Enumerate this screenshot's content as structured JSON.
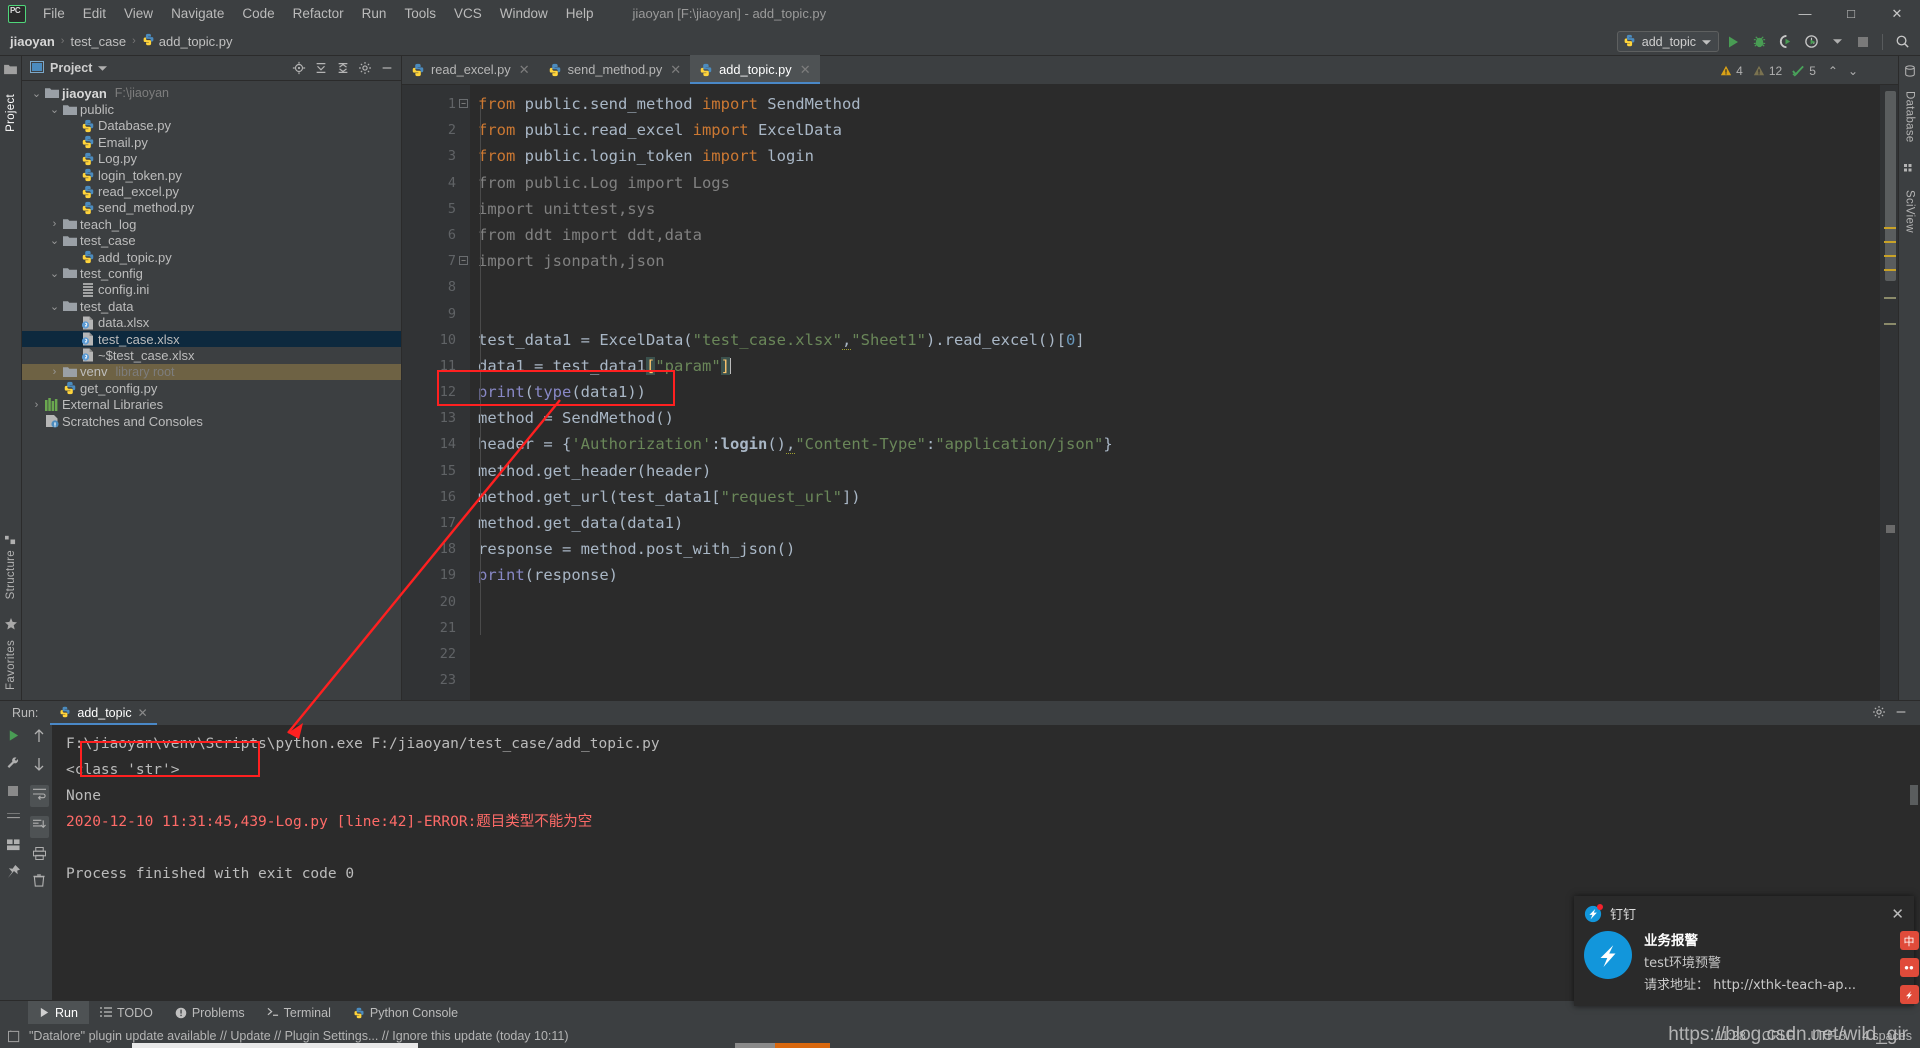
{
  "window": {
    "title": "jiaoyan [F:\\jiaoyan] - add_topic.py",
    "minimize": "—",
    "maximize": "□",
    "close": "✕"
  },
  "menu": {
    "logo": "pycharm-logo",
    "items": [
      "File",
      "Edit",
      "View",
      "Navigate",
      "Code",
      "Refactor",
      "Run",
      "Tools",
      "VCS",
      "Window",
      "Help"
    ]
  },
  "breadcrumb": {
    "items": [
      "jiaoyan",
      "test_case",
      "add_topic.py"
    ],
    "separator": "›"
  },
  "toolbar": {
    "run_config": "add_topic",
    "icons": [
      "run-icon",
      "debug-icon",
      "run-coverage-icon",
      "profile-icon",
      "stop-icon",
      "search-icon"
    ]
  },
  "left_strip": {
    "top": [
      "Project"
    ],
    "bottom": [
      "Structure",
      "Favorites"
    ]
  },
  "right_strip": {
    "items": [
      "Database",
      "SciView"
    ]
  },
  "project_panel": {
    "title": "Project",
    "header_icons": [
      "locate-icon",
      "expand-all-icon",
      "collapse-all-icon",
      "gear-icon",
      "hide-icon"
    ],
    "tree": [
      {
        "depth": 0,
        "twisty": "⌄",
        "icon": "folder-icon",
        "label": "jiaoyan",
        "bold": true,
        "hint": "F:\\jiaoyan",
        "state": "normal"
      },
      {
        "depth": 1,
        "twisty": "⌄",
        "icon": "folder-icon",
        "label": "public",
        "bold": false,
        "hint": "",
        "state": "normal"
      },
      {
        "depth": 2,
        "twisty": "",
        "icon": "python-file-icon",
        "label": "Database.py",
        "bold": false,
        "hint": "",
        "state": "normal"
      },
      {
        "depth": 2,
        "twisty": "",
        "icon": "python-file-icon",
        "label": "Email.py",
        "bold": false,
        "hint": "",
        "state": "normal"
      },
      {
        "depth": 2,
        "twisty": "",
        "icon": "python-file-icon",
        "label": "Log.py",
        "bold": false,
        "hint": "",
        "state": "normal"
      },
      {
        "depth": 2,
        "twisty": "",
        "icon": "python-file-icon",
        "label": "login_token.py",
        "bold": false,
        "hint": "",
        "state": "normal"
      },
      {
        "depth": 2,
        "twisty": "",
        "icon": "python-file-icon",
        "label": "read_excel.py",
        "bold": false,
        "hint": "",
        "state": "normal"
      },
      {
        "depth": 2,
        "twisty": "",
        "icon": "python-file-icon",
        "label": "send_method.py",
        "bold": false,
        "hint": "",
        "state": "normal"
      },
      {
        "depth": 1,
        "twisty": "›",
        "icon": "folder-icon",
        "label": "teach_log",
        "bold": false,
        "hint": "",
        "state": "normal"
      },
      {
        "depth": 1,
        "twisty": "⌄",
        "icon": "folder-icon",
        "label": "test_case",
        "bold": false,
        "hint": "",
        "state": "normal"
      },
      {
        "depth": 2,
        "twisty": "",
        "icon": "python-file-icon",
        "label": "add_topic.py",
        "bold": false,
        "hint": "",
        "state": "normal"
      },
      {
        "depth": 1,
        "twisty": "⌄",
        "icon": "folder-icon",
        "label": "test_config",
        "bold": false,
        "hint": "",
        "state": "normal"
      },
      {
        "depth": 2,
        "twisty": "",
        "icon": "ini-file-icon",
        "label": "config.ini",
        "bold": false,
        "hint": "",
        "state": "normal"
      },
      {
        "depth": 1,
        "twisty": "⌄",
        "icon": "folder-icon",
        "label": "test_data",
        "bold": false,
        "hint": "",
        "state": "normal"
      },
      {
        "depth": 2,
        "twisty": "",
        "icon": "xlsx-file-icon",
        "label": "data.xlsx",
        "bold": false,
        "hint": "",
        "state": "normal"
      },
      {
        "depth": 2,
        "twisty": "",
        "icon": "xlsx-file-icon",
        "label": "test_case.xlsx",
        "bold": false,
        "hint": "",
        "state": "selected"
      },
      {
        "depth": 2,
        "twisty": "",
        "icon": "xlsx-file-icon",
        "label": "~$test_case.xlsx",
        "bold": false,
        "hint": "",
        "state": "normal"
      },
      {
        "depth": 1,
        "twisty": "›",
        "icon": "folder-icon",
        "label": "venv",
        "bold": false,
        "hint": "library root",
        "state": "venv"
      },
      {
        "depth": 1,
        "twisty": "",
        "icon": "python-file-icon",
        "label": "get_config.py",
        "bold": false,
        "hint": "",
        "state": "normal"
      },
      {
        "depth": 0,
        "twisty": "›",
        "icon": "libraries-icon",
        "label": "External Libraries",
        "bold": false,
        "hint": "",
        "state": "normal"
      },
      {
        "depth": 0,
        "twisty": "",
        "icon": "scratches-icon",
        "label": "Scratches and Consoles",
        "bold": false,
        "hint": "",
        "state": "normal"
      }
    ]
  },
  "editor": {
    "tabs": [
      {
        "label": "read_excel.py",
        "active": false
      },
      {
        "label": "send_method.py",
        "active": false
      },
      {
        "label": "add_topic.py",
        "active": true
      }
    ],
    "close_glyph": "✕",
    "inspections": {
      "warnings": "4",
      "weak_warnings": "12",
      "typos": "5",
      "up": "⌃",
      "down": "⌄"
    },
    "line_numbers": [
      "1",
      "2",
      "3",
      "4",
      "5",
      "6",
      "7",
      "8",
      "9",
      "10",
      "11",
      "12",
      "13",
      "14",
      "15",
      "16",
      "17",
      "18",
      "19",
      "20",
      "21",
      "22",
      "23"
    ],
    "lines": [
      "from public.send_method import SendMethod",
      "from public.read_excel import ExcelData",
      "from public.login_token import login",
      "from public.Log import Logs",
      "import unittest,sys",
      "from ddt import ddt,data",
      "import jsonpath,json",
      "",
      "",
      "test_data1 = ExcelData(\"test_case.xlsx\",\"Sheet1\").read_excel()[0]",
      "data1 = test_data1[\"param\"]",
      "print(type(data1))",
      "method = SendMethod()",
      "header = {'Authorization':login(),\"Content-Type\":\"application/json\"}",
      "method.get_header(header)",
      "method.get_url(test_data1[\"request_url\"])",
      "method.get_data(data1)",
      "response = method.post_with_json()",
      "print(response)",
      "",
      "",
      "",
      ""
    ]
  },
  "run_panel": {
    "label": "Run:",
    "tab": "add_topic",
    "close_glyph": "✕",
    "left_icons": [
      "rerun-icon",
      "settings-icon",
      "stop-icon",
      "layout-icon",
      "pin-icon"
    ],
    "second_icons": [
      "scroll-up-icon",
      "scroll-down-icon",
      "soft-wrap-icon",
      "scroll-to-end-icon",
      "print-icon",
      "clear-all-icon"
    ],
    "header_icons": [
      "gear-icon",
      "hide-icon"
    ],
    "output": [
      {
        "text": "F:\\jiaoyan\\venv\\Scripts\\python.exe F:/jiaoyan/test_case/add_topic.py",
        "type": "normal"
      },
      {
        "text": "<class 'str'>",
        "type": "normal"
      },
      {
        "text": "None",
        "type": "normal"
      },
      {
        "text": "2020-12-10 11:31:45,439-Log.py [line:42]-ERROR:题目类型不能为空",
        "type": "error"
      },
      {
        "text": "",
        "type": "normal"
      },
      {
        "text": "Process finished with exit code 0",
        "type": "normal"
      }
    ]
  },
  "tool_windows": [
    {
      "label": "Run",
      "icon": "run-icon",
      "active": true
    },
    {
      "label": "TODO",
      "icon": "todo-icon",
      "active": false
    },
    {
      "label": "Problems",
      "icon": "problems-icon",
      "active": false
    },
    {
      "label": "Terminal",
      "icon": "terminal-icon",
      "active": false
    },
    {
      "label": "Python Console",
      "icon": "python-console-icon",
      "active": false
    }
  ],
  "status_bar": {
    "message": "\"Datalore\" plugin update available // Update // Plugin Settings... // Ignore this update (today 10:11)",
    "icon": "event-log-icon",
    "position": "11:28",
    "line_sep": "CRLF",
    "encoding": "UTF-8",
    "indent": "4 spaces"
  },
  "notification": {
    "app": "钉钉",
    "close": "✕",
    "title": "业务报警",
    "line1": "test环境预警",
    "line2": "请求地址： http://xthk-teach-ap..."
  },
  "watermark": "https://blog.csdn.net/wild_gir",
  "tray": [
    "中",
    "●●"
  ],
  "annotations": {
    "box1": "highlight-print-type-line",
    "box2": "highlight-class-str-output",
    "arrow": "arrow-from-output-to-code"
  },
  "colors": {
    "accent": "#4a88c7",
    "bg": "#3c3f41",
    "editor_bg": "#2b2b2b",
    "keyword": "#cc7832",
    "string": "#6a8759",
    "number": "#6897bb",
    "error": "#ff6b68",
    "annotation": "#ff2020"
  }
}
